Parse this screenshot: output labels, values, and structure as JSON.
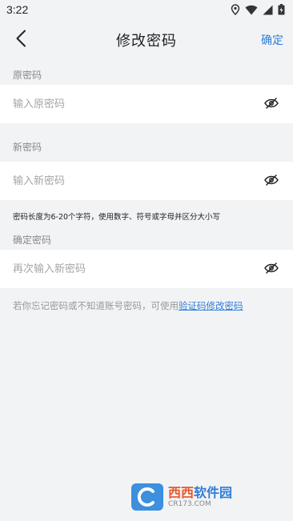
{
  "status_bar": {
    "time": "3:22"
  },
  "header": {
    "title": "修改密码",
    "confirm_label": "确定"
  },
  "old_password": {
    "label": "原密码",
    "placeholder": "输入原密码",
    "value": ""
  },
  "new_password": {
    "label": "新密码",
    "placeholder": "输入新密码",
    "value": ""
  },
  "password_hint": "密码长度为6-20个字符，使用数字、符号或字母并区分大小写",
  "confirm_password": {
    "label": "确定密码",
    "placeholder": "再次输入新密码",
    "value": ""
  },
  "footer": {
    "note": "若你忘记密码或不知道账号密码，可使用",
    "link": "验证码修改密码"
  },
  "watermark": {
    "brand_a": "西西",
    "brand_b": "软件园",
    "sub": "CR173.COM"
  },
  "icons": {
    "back": "chevron-left-icon",
    "eye_hidden": "eye-off-icon",
    "location": "location-icon",
    "wifi": "wifi-icon",
    "signal": "signal-icon",
    "battery": "battery-icon"
  },
  "colors": {
    "accent": "#2f7ed8",
    "background": "#f2f3f5",
    "field_bg": "#ffffff"
  }
}
